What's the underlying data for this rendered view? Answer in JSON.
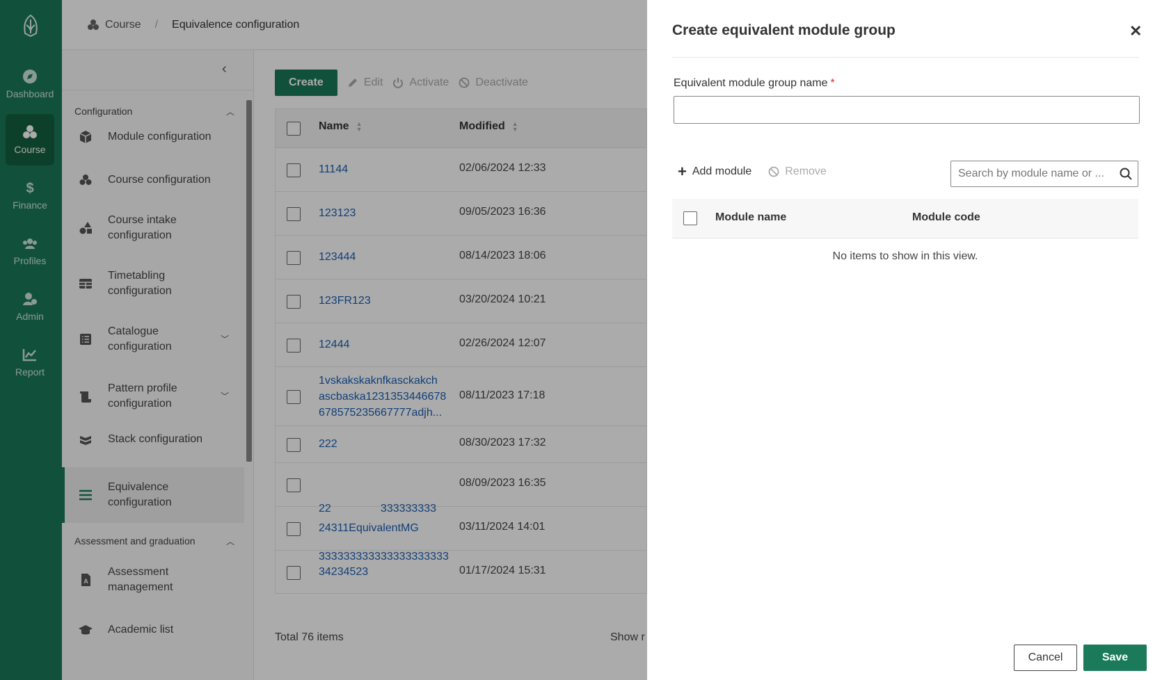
{
  "rail": {
    "items": [
      {
        "label": "Dashboard",
        "icon": "compass-icon"
      },
      {
        "label": "Course",
        "icon": "course-icon"
      },
      {
        "label": "Finance",
        "icon": "dollar-icon"
      },
      {
        "label": "Profiles",
        "icon": "users-icon"
      },
      {
        "label": "Admin",
        "icon": "admin-icon"
      },
      {
        "label": "Report",
        "icon": "chart-icon"
      }
    ],
    "active": "Course"
  },
  "breadcrumb": {
    "root": "Course",
    "separator": "/",
    "current": "Equivalence configuration"
  },
  "sidebar": {
    "collapse_icon": "chevron-left-icon",
    "groups": [
      {
        "label": "Configuration"
      },
      {
        "label": "Assessment and graduation"
      }
    ],
    "items": [
      {
        "label": "Module configuration",
        "icon": "cube-icon"
      },
      {
        "label": "Course configuration",
        "icon": "course-icon"
      },
      {
        "label": "Course intake configuration",
        "icon": "shapes-icon"
      },
      {
        "label": "Timetabling configuration",
        "icon": "table-icon"
      },
      {
        "label": "Catalogue configuration",
        "icon": "list-icon"
      },
      {
        "label": "Pattern profile configuration",
        "icon": "scroll-icon"
      },
      {
        "label": "Stack configuration",
        "icon": "stack-icon"
      },
      {
        "label": "Equivalence configuration",
        "icon": "menu-icon"
      },
      {
        "label": "Assessment management",
        "icon": "assessment-icon"
      },
      {
        "label": "Academic list",
        "icon": "graduation-icon"
      }
    ]
  },
  "toolbar": {
    "create": "Create",
    "edit": "Edit",
    "activate": "Activate",
    "deactivate": "Deactivate"
  },
  "table": {
    "columns": [
      "Name",
      "Modified"
    ],
    "rows": [
      {
        "name": "11144",
        "modified": "02/06/2024 12:33"
      },
      {
        "name": "123123",
        "modified": "09/05/2023 16:36"
      },
      {
        "name": "123444",
        "modified": "08/14/2023 18:06"
      },
      {
        "name": "123FR123",
        "modified": "03/20/2024 10:21"
      },
      {
        "name": "12444",
        "modified": "02/26/2024 12:07"
      },
      {
        "name_lines": [
          "1vskakskaknfkasckakch",
          "ascbaska1231353446678",
          "678575235667777adjh..."
        ],
        "modified": "08/11/2023 17:18"
      },
      {
        "name": "222",
        "modified": "08/30/2023 17:32"
      },
      {
        "name_lines": [
          "22                333333333",
          "333333333333333333333"
        ],
        "modified": "08/09/2023 16:35"
      },
      {
        "name": "24311EquivalentMG",
        "modified": "03/11/2024 14:01"
      },
      {
        "name": "34234523",
        "modified": "01/17/2024 15:31"
      }
    ],
    "total": "Total 76 items",
    "show": "Show r"
  },
  "panel": {
    "title": "Create equivalent module group",
    "field_label": "Equivalent module group name",
    "required_mark": "*",
    "field_value": "",
    "add_module": "Add module",
    "remove": "Remove",
    "search_placeholder": "Search by module name or ...",
    "columns": [
      "Module name",
      "Module code"
    ],
    "empty": "No items to show in this view.",
    "cancel": "Cancel",
    "save": "Save"
  },
  "colors": {
    "brand": "#1a7a5a",
    "link": "#1a5fb4",
    "required": "#d32f2f"
  }
}
